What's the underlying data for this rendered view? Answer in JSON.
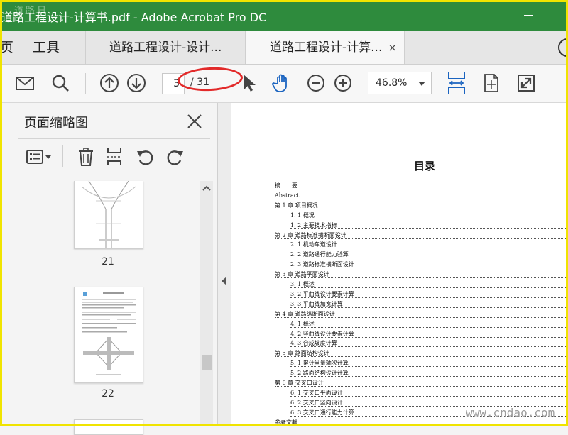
{
  "window": {
    "title": "道路工程设计-计算书.pdf - Adobe Acrobat Pro DC",
    "watermark": "道路日"
  },
  "tabs": {
    "home": "页",
    "tools": "工具",
    "documents": [
      {
        "label": "道路工程设计-设计..."
      },
      {
        "label": "道路工程设计-计算...",
        "close": "×"
      }
    ]
  },
  "toolbar": {
    "current_page": "3",
    "total_pages": "/ 31",
    "zoom": "46.8%"
  },
  "thumbnails_panel": {
    "title": "页面缩略图",
    "pages": [
      {
        "label": "21"
      },
      {
        "label": "22"
      }
    ]
  },
  "document": {
    "heading": "目录",
    "toc": [
      {
        "text": "摘　　要",
        "level": 0
      },
      {
        "text": "Abstract",
        "level": 0
      },
      {
        "text": "第 1 章  项目概况",
        "level": 0
      },
      {
        "text": "1. 1  概况",
        "level": 1
      },
      {
        "text": "1. 2  主要技术指标",
        "level": 1
      },
      {
        "text": "第 2 章  道路标准横断面设计",
        "level": 0
      },
      {
        "text": "2. 1  机动车道设计",
        "level": 1
      },
      {
        "text": "2. 2  道路通行能力验算",
        "level": 1
      },
      {
        "text": "2. 3  道路标准横断面设计",
        "level": 1
      },
      {
        "text": "第 3 章  道路平面设计",
        "level": 0
      },
      {
        "text": "3. 1  概述",
        "level": 1
      },
      {
        "text": "3. 2  平曲线设计要素计算",
        "level": 1
      },
      {
        "text": "3. 3  平曲线加宽计算",
        "level": 1
      },
      {
        "text": "第 4 章  道路纵断面设计",
        "level": 0
      },
      {
        "text": "4. 1  概述",
        "level": 1
      },
      {
        "text": "4. 2  竖曲线设计要素计算",
        "level": 1
      },
      {
        "text": "4. 3  合成坡度计算",
        "level": 1
      },
      {
        "text": "第 5 章  路面结构设计",
        "level": 0
      },
      {
        "text": "5. 1  累计当量轴次计算",
        "level": 1
      },
      {
        "text": "5. 2  路面结构设计计算",
        "level": 1
      },
      {
        "text": "第 6 章  交叉口设计",
        "level": 0
      },
      {
        "text": "6. 1  交叉口平面设计",
        "level": 1
      },
      {
        "text": "6. 2  交叉口竖向设计",
        "level": 1
      },
      {
        "text": "6. 3  交叉口通行能力计算",
        "level": 1
      },
      {
        "text": "参考文献",
        "level": 0
      }
    ]
  },
  "footer_watermark": "www.cndao.com"
}
